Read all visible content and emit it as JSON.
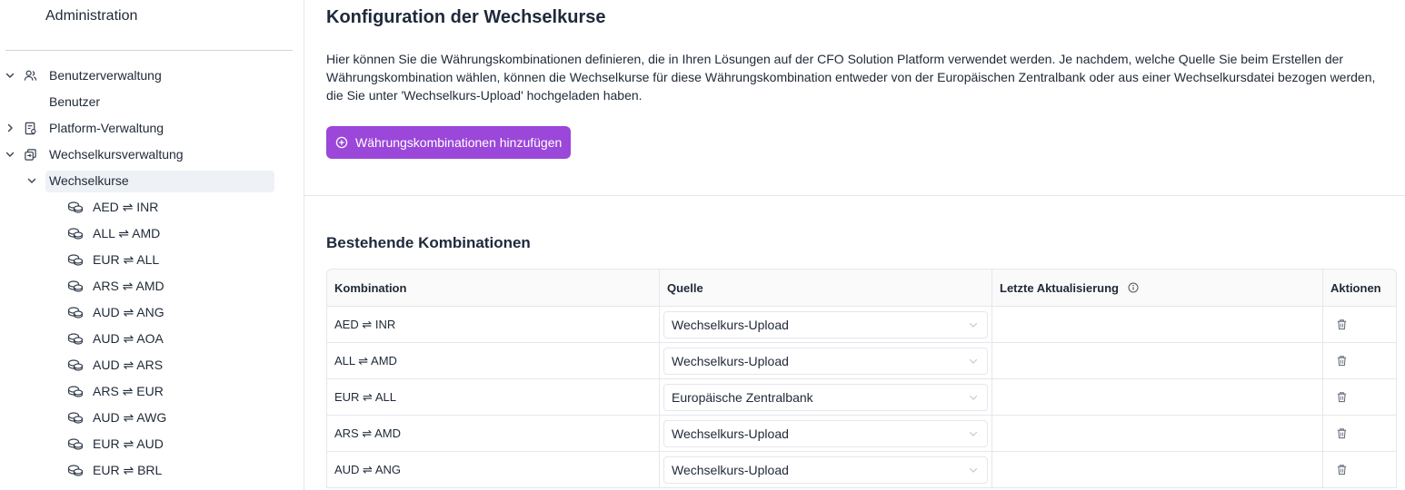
{
  "sidebar": {
    "title": "Administration",
    "groups": {
      "benutzerverwaltung": {
        "label": "Benutzerverwaltung",
        "child": "Benutzer"
      },
      "platform": {
        "label": "Platform-Verwaltung"
      },
      "wechselkursverwaltung": {
        "label": "Wechselkursverwaltung",
        "child": "Wechselkurse"
      }
    },
    "currency_pairs": [
      "AED ⇌ INR",
      "ALL ⇌ AMD",
      "EUR ⇌ ALL",
      "ARS ⇌ AMD",
      "AUD ⇌ ANG",
      "AUD ⇌ AOA",
      "AUD ⇌ ARS",
      "ARS ⇌ EUR",
      "AUD ⇌ AWG",
      "EUR ⇌ AUD",
      "EUR ⇌ BRL"
    ]
  },
  "main": {
    "title": "Konfiguration der Wechselkurse",
    "description": "Hier können Sie die Währungskombinationen definieren, die in Ihren Lösungen auf der CFO Solution Platform verwendet werden. Je nachdem, welche Quelle Sie beim Erstellen der Währungskombination wählen, können die Wechselkurse für diese Währungskombination entweder von der Europäischen Zentralbank oder aus einer Wechselkursdatei bezogen werden, die Sie unter 'Wechselkurs-Upload' hochgeladen haben.",
    "add_button_label": "Währungskombinationen hinzufügen",
    "section_title": "Bestehende Kombinationen",
    "table": {
      "headers": {
        "combination": "Kombination",
        "source": "Quelle",
        "last_update": "Letzte Aktualisierung",
        "actions": "Aktionen"
      },
      "rows": [
        {
          "combination": "AED ⇌ INR",
          "source": "Wechselkurs-Upload",
          "last_update": ""
        },
        {
          "combination": "ALL ⇌ AMD",
          "source": "Wechselkurs-Upload",
          "last_update": ""
        },
        {
          "combination": "EUR ⇌ ALL",
          "source": "Europäische Zentralbank",
          "last_update": ""
        },
        {
          "combination": "ARS ⇌ AMD",
          "source": "Wechselkurs-Upload",
          "last_update": ""
        },
        {
          "combination": "AUD ⇌ ANG",
          "source": "Wechselkurs-Upload",
          "last_update": ""
        }
      ]
    }
  },
  "colors": {
    "accent": "#9b47d9",
    "selected_bg": "#eef2f6",
    "border": "#e5e7eb"
  },
  "icons": {
    "chevron_expanded": "chevron-down-icon",
    "chevron_collapsed": "chevron-right-icon",
    "users": "users-icon",
    "platform": "document-settings-icon",
    "exchange": "exchange-icon",
    "coins": "coins-icon",
    "add": "plus-circle-icon",
    "info": "info-icon",
    "delete": "trash-icon"
  }
}
